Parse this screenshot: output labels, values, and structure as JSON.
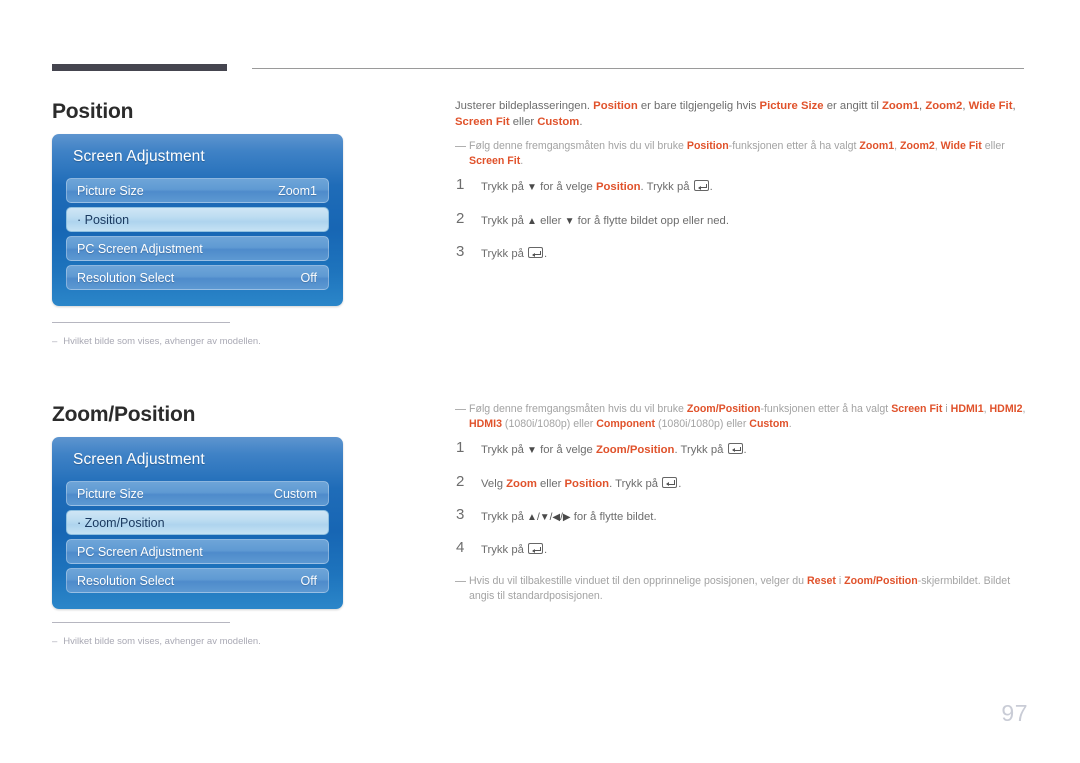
{
  "page": {
    "number": "97"
  },
  "sections": [
    {
      "heading": "Position",
      "osd": {
        "title": "Screen Adjustment",
        "rows": [
          {
            "label": "Picture Size",
            "value": "Zoom1",
            "selected": false
          },
          {
            "label": "· Position",
            "value": "",
            "selected": true
          },
          {
            "label": "PC Screen Adjustment",
            "value": "",
            "selected": false
          },
          {
            "label": "Resolution Select",
            "value": "Off",
            "selected": false
          }
        ]
      },
      "footnote": {
        "dash": "–",
        "text": "Hvilket bilde som vises, avhenger av modellen."
      },
      "intro": {
        "t1": "Justerer bildeplasseringen. ",
        "h1": "Position",
        "t2": " er bare tilgjengelig hvis ",
        "h2": "Picture Size",
        "t3": " er angitt til ",
        "h3": "Zoom1",
        "t4": ", ",
        "h4": "Zoom2",
        "t5": ", ",
        "h5": "Wide Fit",
        "t6": ", ",
        "h6": "Screen Fit",
        "t7": " eller ",
        "h7": "Custom",
        "t8": "."
      },
      "note": {
        "t1": "Følg denne fremgangsmåten hvis du vil bruke ",
        "h1": "Position",
        "t2": "-funksjonen etter å ha valgt ",
        "h2": "Zoom1",
        "t3": ", ",
        "h3": "Zoom2",
        "t4": ", ",
        "h4": "Wide Fit",
        "t5": " eller ",
        "h5": "Screen Fit",
        "t6": "."
      },
      "steps": [
        {
          "num": "1",
          "t1": "Trykk på ",
          "arrow": "▼",
          "t2": " for å velge ",
          "h1": "Position",
          "t3": ". Trykk på ",
          "t4": "."
        },
        {
          "num": "2",
          "t1": "Trykk på ",
          "arrow": "▲",
          "t2": " eller ",
          "arrow2": "▼",
          "t3": " for å flytte bildet opp eller ned."
        },
        {
          "num": "3",
          "t1": "Trykk på ",
          "t4": "."
        }
      ]
    },
    {
      "heading": "Zoom/Position",
      "osd": {
        "title": "Screen Adjustment",
        "rows": [
          {
            "label": "Picture Size",
            "value": "Custom",
            "selected": false
          },
          {
            "label": "· Zoom/Position",
            "value": "",
            "selected": true
          },
          {
            "label": "PC Screen Adjustment",
            "value": "",
            "selected": false
          },
          {
            "label": "Resolution Select",
            "value": "Off",
            "selected": false
          }
        ]
      },
      "footnote": {
        "dash": "–",
        "text": "Hvilket bilde som vises, avhenger av modellen."
      },
      "note": {
        "t1": "Følg denne fremgangsmåten hvis du vil bruke ",
        "h1": "Zoom/Position",
        "t2": "-funksjonen etter å ha valgt ",
        "h2": "Screen Fit",
        "t3": " i ",
        "h3": "HDMI1",
        "t4": ", ",
        "h4": "HDMI2",
        "t5": ", ",
        "h5": "HDMI3",
        "t6": " (1080i/1080p) eller ",
        "h6": "Component",
        "t7": " (1080i/1080p) eller ",
        "h7": "Custom",
        "t8": "."
      },
      "steps": [
        {
          "num": "1",
          "t1": "Trykk på ",
          "arrow": "▼",
          "t2": " for å velge ",
          "h1": "Zoom/Position",
          "t3": ". Trykk på ",
          "t4": "."
        },
        {
          "num": "2",
          "t1": "Velg ",
          "h1": "Zoom",
          "t2": " eller ",
          "h2": "Position",
          "t3": ". Trykk på ",
          "t4": "."
        },
        {
          "num": "3",
          "t1": "Trykk på ",
          "arrows": "▲/▼/◀/▶",
          "t3": " for å flytte bildet."
        },
        {
          "num": "4",
          "t1": "Trykk på ",
          "t4": "."
        }
      ],
      "endnote": {
        "t1": "Hvis du vil tilbakestille vinduet til den opprinnelige posisjonen, velger du ",
        "h1": "Reset",
        "t2": " i ",
        "h2": "Zoom/Position",
        "t3": "-skjermbildet. Bildet angis til standardposisjonen."
      }
    }
  ],
  "colors": {
    "accent": "#e0522b",
    "rule_dark": "#45454f",
    "osd_blue": "#1f6cb8",
    "osd_selected": "#bcdcf1",
    "page_number": "#c9ccd6"
  }
}
